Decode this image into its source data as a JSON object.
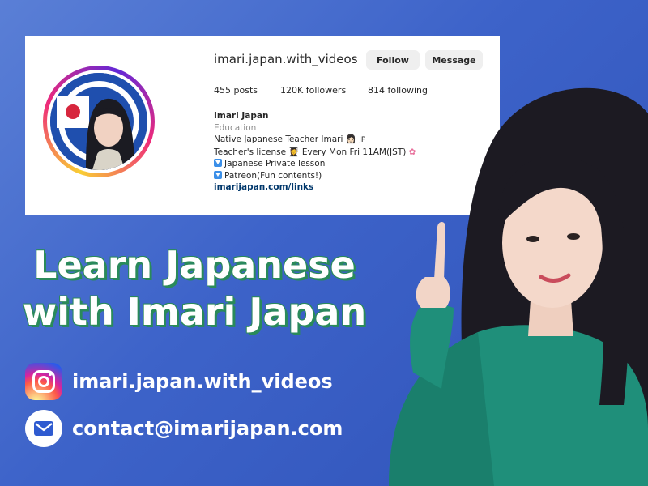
{
  "profile": {
    "username": "imari.japan.with_videos",
    "follow_label": "Follow",
    "message_label": "Message",
    "posts_count": "455",
    "posts_label": "posts",
    "followers_count": "120K",
    "followers_label": "followers",
    "following_count": "814",
    "following_label": "following",
    "name": "Imari Japan",
    "category": "Education",
    "bio_line1": "Native Japanese Teacher Imari",
    "bio_line1_suffix": "JP",
    "bio_line2": "Teacher's license",
    "bio_line2_rest": "Every Mon Fri 11AM(JST)",
    "bio_line3": "Japanese Private lesson",
    "bio_line4": "Patreon(Fun contents!)",
    "link": "imarijapan.com/links"
  },
  "headline": {
    "line1": "Learn Japanese",
    "line2": "with Imari Japan"
  },
  "contacts": {
    "instagram": "imari.japan.with_videos",
    "email": "contact@imarijapan.com"
  },
  "icons": {
    "instagram": "instagram-icon",
    "mail": "mail-icon",
    "download_arrow": "down-arrow-box-icon"
  },
  "colors": {
    "background": "#3d63c9",
    "headline_outline": "#2a8a5a",
    "link": "#00376b"
  }
}
